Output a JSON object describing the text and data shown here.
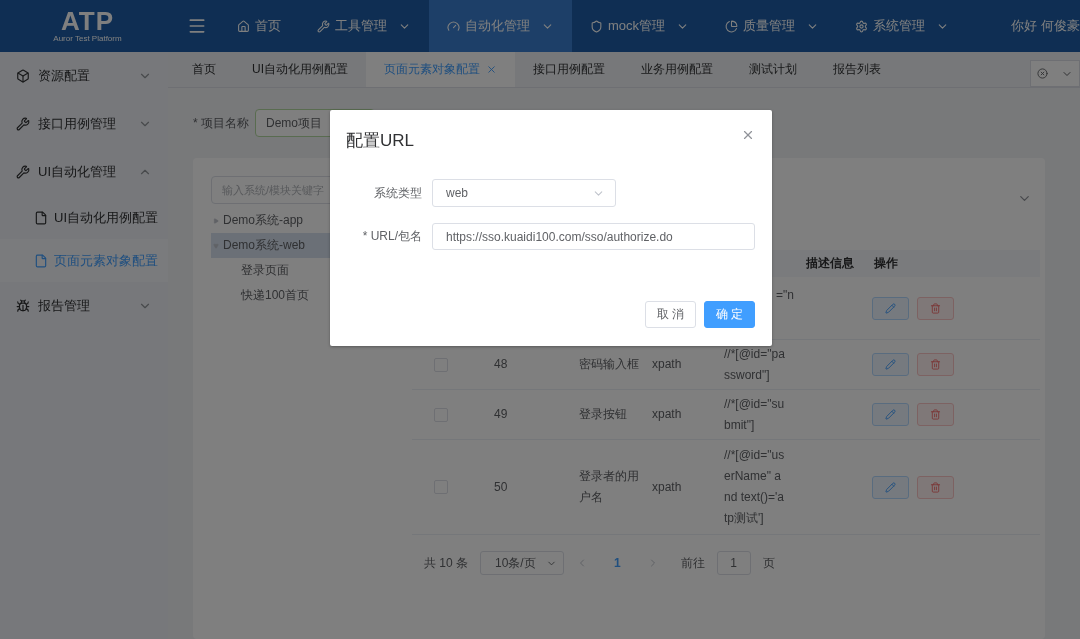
{
  "header": {
    "logo": "ATP",
    "logo_subtitle": "Auror Test Platform",
    "nav": [
      {
        "label": "首页",
        "selected": false,
        "dropdown": false
      },
      {
        "label": "工具管理",
        "selected": false,
        "dropdown": true
      },
      {
        "label": "自动化管理",
        "selected": true,
        "dropdown": true
      },
      {
        "label": "mock管理",
        "selected": false,
        "dropdown": true
      },
      {
        "label": "质量管理",
        "selected": false,
        "dropdown": true
      },
      {
        "label": "系统管理",
        "selected": false,
        "dropdown": true
      }
    ],
    "user": "你好 何俊豪"
  },
  "sidebar": {
    "items": [
      {
        "label": "资源配置",
        "expanded": false
      },
      {
        "label": "接口用例管理",
        "expanded": false
      },
      {
        "label": "UI自动化管理",
        "expanded": true,
        "children": [
          {
            "label": "UI自动化用例配置",
            "selected": false
          },
          {
            "label": "页面元素对象配置",
            "selected": true
          }
        ]
      },
      {
        "label": "报告管理",
        "expanded": false
      }
    ]
  },
  "tabs": [
    {
      "label": "首页",
      "selected": false,
      "closable": false
    },
    {
      "label": "UI自动化用例配置",
      "selected": false,
      "closable": false
    },
    {
      "label": "页面元素对象配置",
      "selected": true,
      "closable": true
    },
    {
      "label": "接口用例配置",
      "selected": false,
      "closable": false
    },
    {
      "label": "业务用例配置",
      "selected": false,
      "closable": false
    },
    {
      "label": "测试计划",
      "selected": false,
      "closable": false
    },
    {
      "label": "报告列表",
      "selected": false,
      "closable": false
    }
  ],
  "project": {
    "label": "* 项目名称",
    "value": "Demo项目"
  },
  "tree": {
    "placeholder": "输入系统/模块关键字",
    "items": [
      {
        "label": "Demo系统-app",
        "expanded": false,
        "selected": false
      },
      {
        "label": "Demo系统-web",
        "expanded": true,
        "selected": true,
        "children": [
          {
            "label": "登录页面"
          },
          {
            "label": "快递100首页"
          }
        ]
      }
    ]
  },
  "table": {
    "columns": [
      "描述信息",
      "操作"
    ],
    "rows": [
      {
        "clipped": true,
        "locator": "=\"n"
      },
      {
        "clipped": false,
        "checked": false,
        "number": "48",
        "name": "密码输入框",
        "type": "xpath",
        "locator": "//*[@id=\"password\"]"
      },
      {
        "clipped": false,
        "checked": false,
        "number": "49",
        "name": "登录按钮",
        "type": "xpath",
        "locator": "//*[@id=\"submit\"]"
      },
      {
        "clipped": false,
        "checked": false,
        "number": "50",
        "name": "登录者的用户名",
        "type": "xpath",
        "locator": "//*[@id=\"userName\" and text()='atp测试']"
      }
    ]
  },
  "pagination": {
    "total": "共 10 条",
    "page_size": "10条/页",
    "pages": [
      {
        "label": "1",
        "selected": true
      }
    ],
    "goto_label": "前往",
    "goto_value": "1",
    "goto_suffix": "页"
  },
  "dialog": {
    "title": "配置URL",
    "fields": [
      {
        "kind": "select",
        "label": "系统类型",
        "value": "web"
      },
      {
        "kind": "input",
        "label": "* URL/包名",
        "value": "https://sso.kuaidi100.com/sso/authorize.do"
      }
    ],
    "buttons": [
      {
        "label": "取 消",
        "primary": false
      },
      {
        "label": "确 定",
        "primary": true
      }
    ]
  }
}
